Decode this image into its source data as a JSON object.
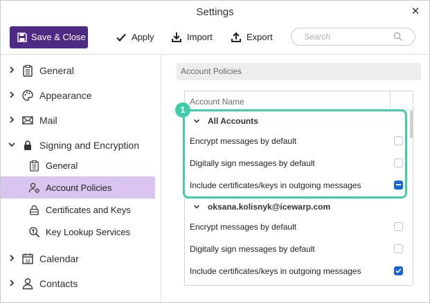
{
  "window": {
    "title": "Settings"
  },
  "toolbar": {
    "save_close": "Save & Close",
    "apply": "Apply",
    "import": "Import",
    "export": "Export",
    "search_placeholder": "Search"
  },
  "sidebar": {
    "items": [
      {
        "label": "General",
        "icon": "clipboard-icon",
        "expanded": false
      },
      {
        "label": "Appearance",
        "icon": "palette-icon",
        "expanded": false
      },
      {
        "label": "Mail",
        "icon": "envelope-icon",
        "expanded": false
      },
      {
        "label": "Signing and Encryption",
        "icon": "lock-icon",
        "expanded": true
      },
      {
        "label": "Calendar",
        "icon": "calendar-icon",
        "expanded": false
      },
      {
        "label": "Contacts",
        "icon": "person-icon",
        "expanded": false
      }
    ],
    "subitems": [
      {
        "label": "General",
        "icon": "clipboard-icon",
        "active": false
      },
      {
        "label": "Account Policies",
        "icon": "user-settings-icon",
        "active": true
      },
      {
        "label": "Certificates and Keys",
        "icon": "lock-outline-icon",
        "active": false
      },
      {
        "label": "Key Lookup Services",
        "icon": "key-search-icon",
        "active": false
      }
    ],
    "calendar_day": "12"
  },
  "main": {
    "section_title": "Account Policies",
    "column_header": "Account Name",
    "groups": [
      {
        "name": "All Accounts",
        "options": [
          {
            "label": "Encrypt messages by default",
            "state": "unchecked"
          },
          {
            "label": "Digitally sign messages by default",
            "state": "unchecked"
          },
          {
            "label": "Include certificates/keys in outgoing messages",
            "state": "indeterminate"
          }
        ]
      },
      {
        "name": "oksana.kolisnyk@icewarp.com",
        "options": [
          {
            "label": "Encrypt messages by default",
            "state": "unchecked"
          },
          {
            "label": "Digitally sign messages by default",
            "state": "unchecked"
          },
          {
            "label": "Include certificates/keys in outgoing messages",
            "state": "checked"
          }
        ]
      }
    ],
    "callout_number": "1"
  },
  "colors": {
    "primary": "#4e2a84",
    "active_item": "#dac5f0",
    "highlight": "#3fcdaa",
    "checkbox_blue": "#1765d8"
  }
}
